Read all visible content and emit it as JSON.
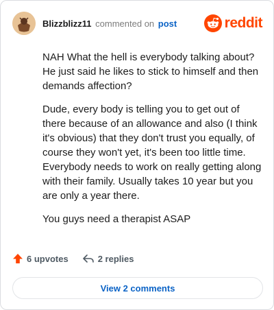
{
  "header": {
    "username": "Blizzblizz11",
    "commented_text": "commented on",
    "post_link": "post",
    "brand": "reddit"
  },
  "comment": {
    "paragraphs": [
      "NAH What the hell is everybody talking about? He just said he likes to stick to himself and then demands affection?",
      "Dude, every body is telling you to get out of there because of an allowance and also (I think it's obvious) that they don't trust you equally, of course they won't yet, it's been too little time. Everybody needs to work on really getting along with their family. Usually takes 10 year but you are only a year there.",
      "You guys need a therapist ASAP"
    ]
  },
  "actions": {
    "upvotes": "6 upvotes",
    "replies": "2 replies"
  },
  "footer": {
    "view_comments": "View 2 comments"
  },
  "colors": {
    "brand": "#ff4500",
    "link": "#0b63c6"
  }
}
